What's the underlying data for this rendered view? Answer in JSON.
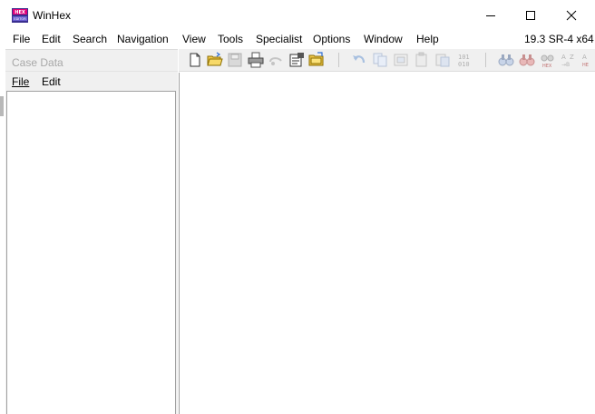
{
  "window": {
    "title": "WinHex",
    "minimize_icon": "minimize-icon",
    "maximize_icon": "maximize-icon",
    "close_icon": "close-icon"
  },
  "menubar": {
    "items": [
      "File",
      "Edit",
      "Search",
      "Navigation",
      "View",
      "Tools",
      "Specialist",
      "Options",
      "Window",
      "Help"
    ],
    "version": "19.3 SR-4 x64"
  },
  "case_panel": {
    "title": "Case Data",
    "menu": [
      "File",
      "Edit"
    ]
  },
  "toolbar": {
    "buttons": [
      "new-file-icon",
      "open-file-icon",
      "save-icon",
      "print-icon",
      "undo-history-icon",
      "properties-icon",
      "open-folder-icon",
      "undo-icon",
      "copy-icon",
      "cut-icon",
      "paste-icon",
      "paste-special-icon",
      "write-binary-icon",
      "find-icon",
      "find-replace-icon",
      "find-hex-icon",
      "replace-text-icon"
    ]
  },
  "colors": {
    "chrome": "#f0f0f0",
    "border": "#a0a0a0",
    "disabled": "#a8a8a8"
  }
}
